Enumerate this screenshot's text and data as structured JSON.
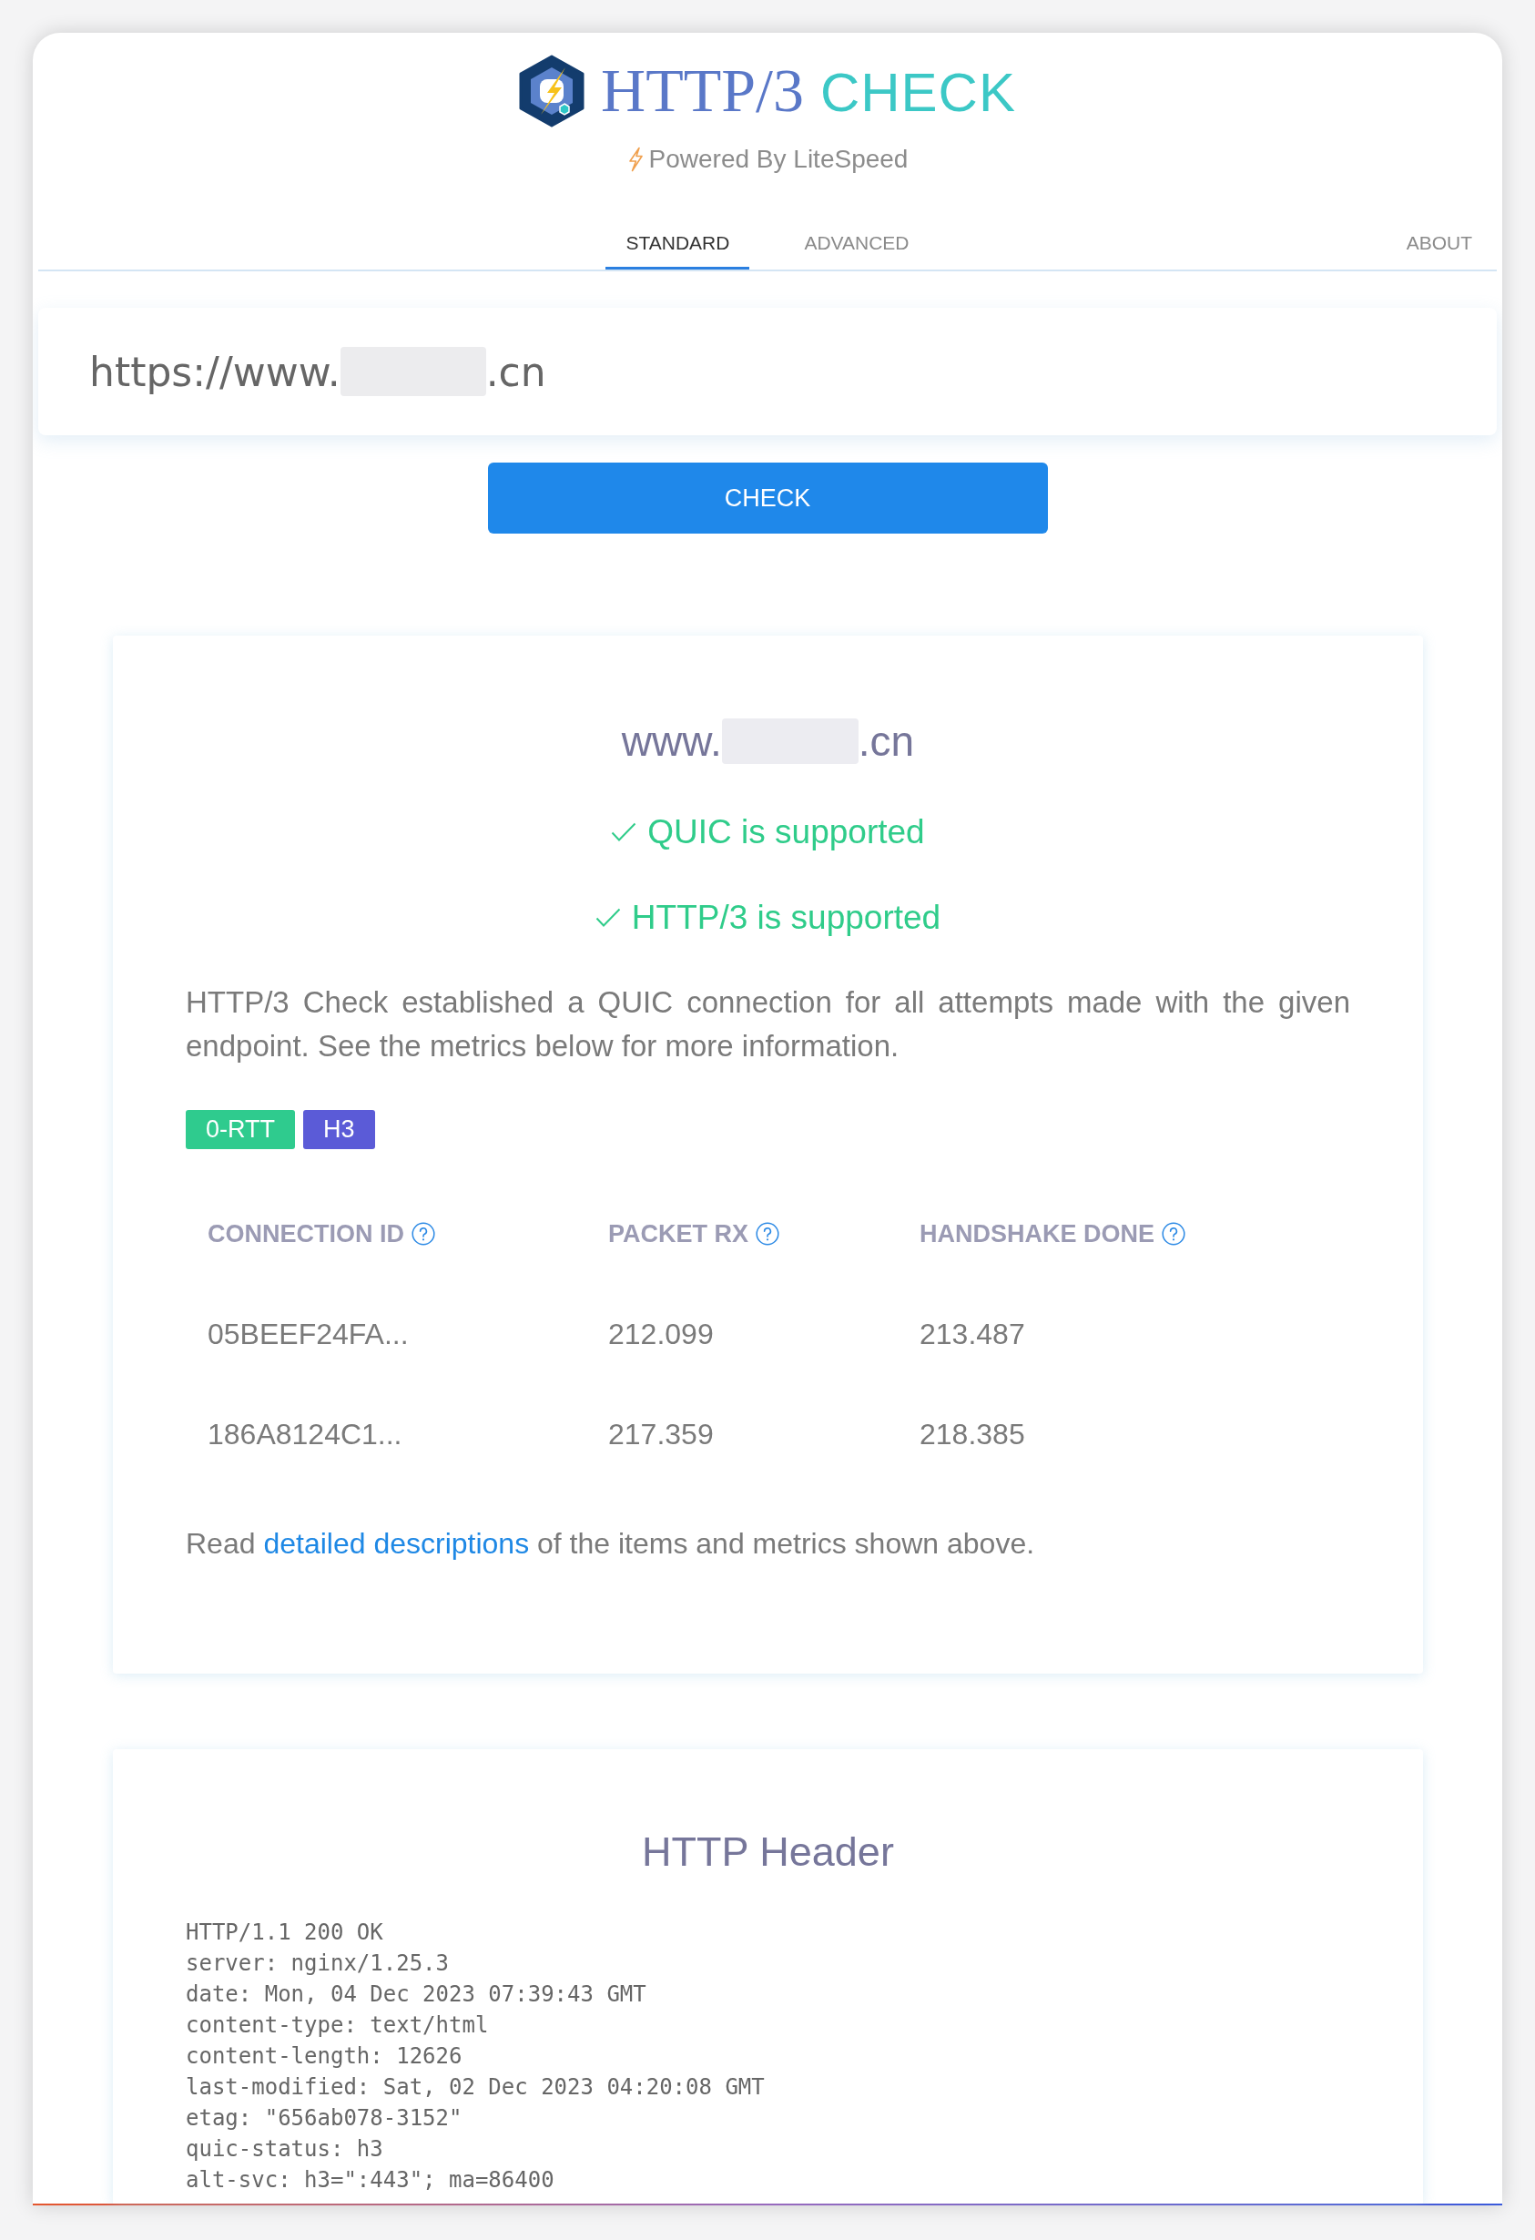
{
  "header": {
    "title": {
      "primary": "HTTP/3",
      "accent": "CHECK"
    },
    "tagline": "Powered By LiteSpeed"
  },
  "tabs": [
    {
      "label": "STANDARD",
      "selected": true
    },
    {
      "label": "ADVANCED",
      "selected": false
    }
  ],
  "about_tab": {
    "label": "ABOUT",
    "selected": false
  },
  "url_field": {
    "value_parts": [
      "https://www.",
      ".cn"
    ]
  },
  "check_button": {
    "label": "CHECK"
  },
  "result": {
    "domain_parts": [
      "www.",
      ".cn"
    ],
    "checks": [
      {
        "label": "QUIC is supported",
        "passed": true
      },
      {
        "label": "HTTP/3 is supported",
        "passed": true
      }
    ],
    "description": "HTTP/3 Check established a QUIC connection for all attempts made with the given endpoint. See the metrics below for more information.",
    "tags": [
      {
        "label": "0-RTT",
        "color": "#2fcb8e"
      },
      {
        "label": "H3",
        "color": "#5b5bd7"
      }
    ],
    "table": {
      "columns": [
        {
          "label": "CONNECTION ID"
        },
        {
          "label": "PACKET RX"
        },
        {
          "label": "HANDSHAKE DONE"
        }
      ],
      "rows": [
        {
          "cells": [
            "05BEEF24FA...",
            "212.099",
            "213.487"
          ]
        },
        {
          "cells": [
            "186A8124C1...",
            "217.359",
            "218.385"
          ]
        }
      ]
    },
    "note": {
      "before": "Read ",
      "link": "detailed descriptions",
      "after": " of the items and metrics shown above."
    }
  },
  "http_header": {
    "title": "HTTP Header",
    "lines": [
      "HTTP/1.1 200 OK",
      "server: nginx/1.25.3",
      "date: Mon, 04 Dec 2023 07:39:43 GMT",
      "content-type: text/html",
      "content-length: 12626",
      "last-modified: Sat, 02 Dec 2023 04:20:08 GMT",
      "etag: \"656ab078-3152\"",
      "quic-status: h3",
      "alt-svc: h3=\":443\"; ma=86400"
    ]
  }
}
